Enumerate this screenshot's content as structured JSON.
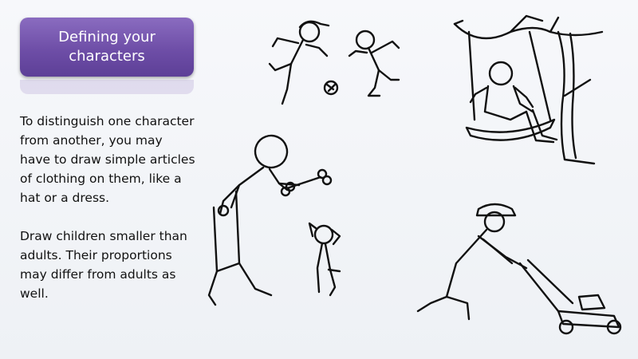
{
  "slide": {
    "title": "Defining your characters",
    "paragraphs": [
      "To distinguish one character from another, you may have to draw simple articles of clothing on them, like a hat or a dress.",
      "Draw children smaller than adults. Their proportions may differ from adults as well."
    ]
  },
  "illustrations": [
    "soccer-players-icon",
    "child-on-swing-icon",
    "woman-with-dog-and-bone-icon",
    "man-mowing-lawn-icon"
  ]
}
